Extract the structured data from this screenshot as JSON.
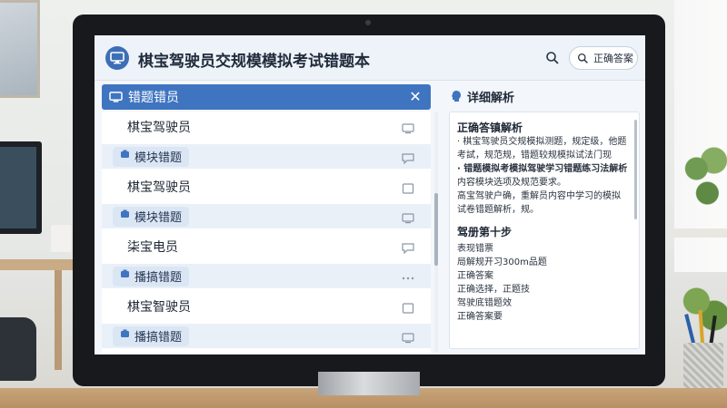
{
  "app": {
    "title": "棋宝驾驶员交规模模拟考试错题本",
    "answer_button_label": "正确答案",
    "accent_color": "#3f74c0"
  },
  "list": {
    "header_label": "错题错员",
    "items": [
      {
        "type": "plain",
        "label": "棋宝驾驶员",
        "icon": "monitor-icon"
      },
      {
        "type": "tag",
        "label": "模块错题",
        "icon": "chat-icon"
      },
      {
        "type": "plain",
        "label": "棋宝驾驶员",
        "icon": "square-icon"
      },
      {
        "type": "tag",
        "label": "模块错题",
        "icon": "monitor-icon"
      },
      {
        "type": "plain",
        "label": "柒宝电员",
        "icon": "chat-icon"
      },
      {
        "type": "tag",
        "label": "播搞错题",
        "icon": "more-icon"
      },
      {
        "type": "plain",
        "label": "棋宝智驶员",
        "icon": "square-icon"
      },
      {
        "type": "tag",
        "label": "播搞错题",
        "icon": "monitor-icon"
      }
    ]
  },
  "detail": {
    "header_label": "详细解析",
    "section1_title": "正确答镇解析",
    "section1_lines": [
      "· 棋宝驾驶员交规模拟测题，规定级，他题",
      "  考試，规范规，错题较规模拟试法门现",
      "· 错题模拟考模拟驾驶学习错题练习法解析",
      "  内容模块选项及规范要求。",
      "  高宝驾驶户确，重解员内容中学习的模拟",
      "  试卷错题解析，规。"
    ],
    "section2_title": "驾册第十步",
    "section2_lines": [
      "表现错票",
      "局解规开习300m品题",
      "正确答案",
      "正确选择，正题技",
      "驾驶底错题效",
      "正确答案要"
    ]
  }
}
